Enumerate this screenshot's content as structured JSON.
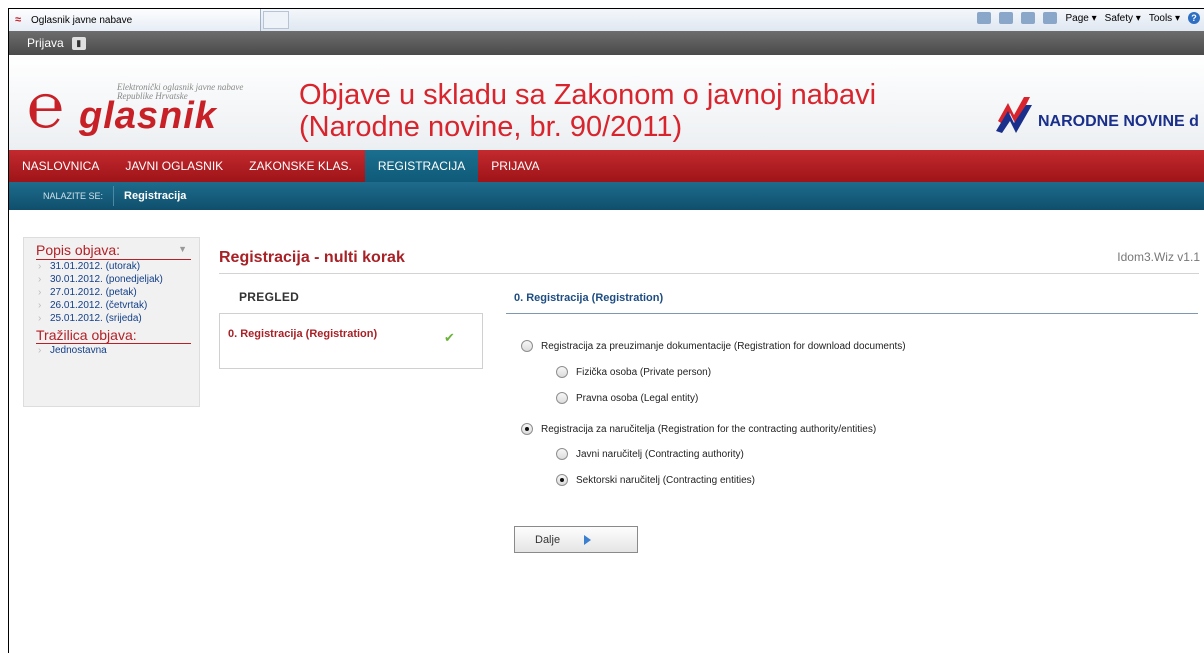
{
  "browser": {
    "tab_title": "Oglasnik javne nabave",
    "tools": [
      "Page",
      "Safety",
      "Tools"
    ]
  },
  "topbar": {
    "prijava": "Prijava"
  },
  "header": {
    "logo_word": "glasnik",
    "logo_sub": "Elektronički oglasnik javne nabave Republike Hrvatske",
    "title_line1": "Objave u skladu sa Zakonom o javnoj nabavi",
    "title_line2": "(Narodne novine, br. 90/2011)",
    "nn_text": "NARODNE NOVINE d"
  },
  "nav": [
    {
      "label": "NASLOVNICA"
    },
    {
      "label": "JAVNI OGLASNIK"
    },
    {
      "label": "ZAKONSKE KLAS."
    },
    {
      "label": "REGISTRACIJA"
    },
    {
      "label": "PRIJAVA"
    }
  ],
  "breadcrumb": {
    "label": "NALAZITE SE:",
    "current": "Registracija"
  },
  "sidebar": {
    "head1": "Popis objava:",
    "links": [
      "31.01.2012. (utorak)",
      "30.01.2012. (ponedjeljak)",
      "27.01.2012. (petak)",
      "26.01.2012. (četvrtak)",
      "25.01.2012. (srijeda)"
    ],
    "head2": "Tražilica objava:",
    "link2": "Jednostavna"
  },
  "main": {
    "title": "Registracija - nulti korak",
    "version": "Idom3.Wiz v1.1",
    "pregled": "PREGLED",
    "step": "0. Registracija (Registration)",
    "section_title": "0. Registracija (Registration)",
    "options": {
      "download": "Registracija za preuzimanje dokumentacije (Registration for download documents)",
      "private": "Fizička osoba (Private person)",
      "legal": "Pravna osoba (Legal entity)",
      "authority": "Registracija za naručitelja (Registration for the contracting authority/entities)",
      "public": "Javni naručitelj (Contracting authority)",
      "sector": "Sektorski naručitelj (Contracting entities)"
    },
    "next_button": "Dalje"
  }
}
